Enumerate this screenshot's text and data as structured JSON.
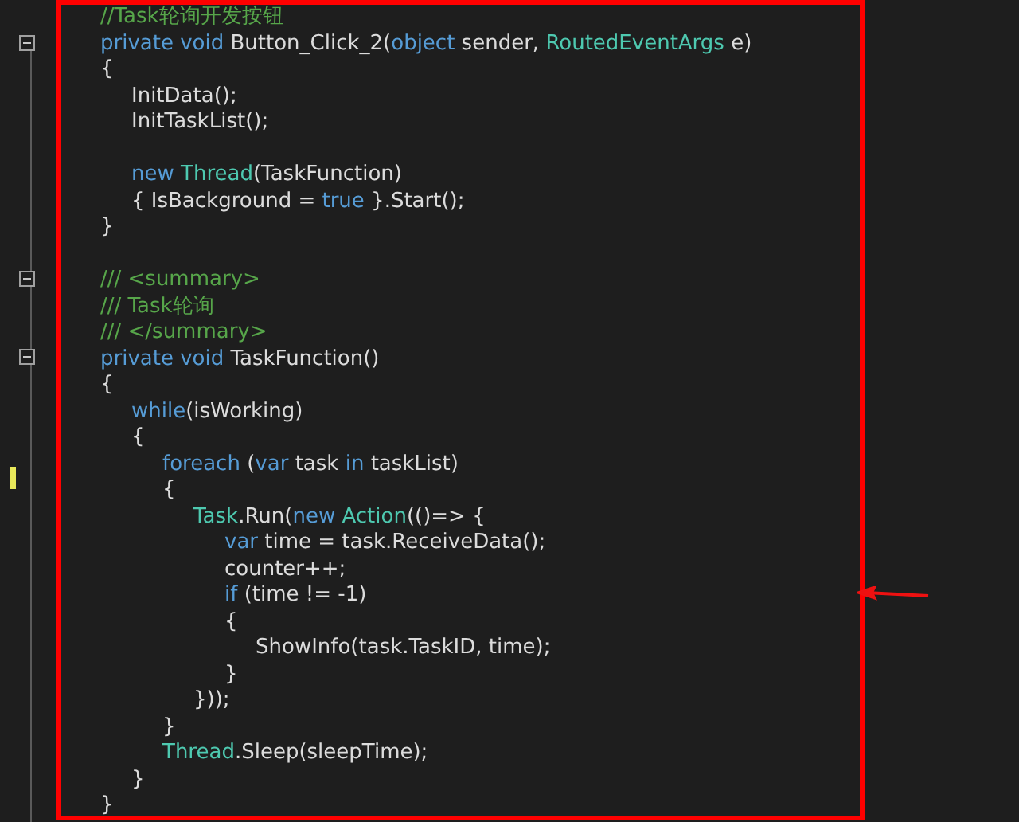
{
  "editor": {
    "lines": [
      {
        "fold": false,
        "changed": false,
        "tokens": [
          {
            "kind": "comment",
            "text": "//Task轮询开发按钮"
          }
        ]
      },
      {
        "fold": true,
        "changed": false,
        "tokens": [
          {
            "kind": "keyword",
            "text": "private void"
          },
          {
            "kind": "plain",
            "text": " Button_Click_2("
          },
          {
            "kind": "keyword",
            "text": "object"
          },
          {
            "kind": "plain",
            "text": " sender, "
          },
          {
            "kind": "type",
            "text": "RoutedEventArgs"
          },
          {
            "kind": "plain",
            "text": " e)"
          }
        ]
      },
      {
        "fold": false,
        "changed": false,
        "tokens": [
          {
            "kind": "plain",
            "text": "{"
          }
        ],
        "children": [
          {
            "fold": false,
            "changed": false,
            "tokens": [
              {
                "kind": "plain",
                "text": "InitData();"
              }
            ]
          },
          {
            "fold": false,
            "changed": false,
            "tokens": [
              {
                "kind": "plain",
                "text": "InitTaskList();"
              }
            ]
          },
          {
            "fold": false,
            "changed": false
          },
          {
            "fold": false,
            "changed": false,
            "tokens": [
              {
                "kind": "keyword",
                "text": "new "
              },
              {
                "kind": "type",
                "text": "Thread"
              },
              {
                "kind": "plain",
                "text": "(TaskFunction)"
              }
            ]
          },
          {
            "fold": false,
            "changed": false,
            "tokens": [
              {
                "kind": "plain",
                "text": "{ IsBackground = "
              },
              {
                "kind": "keyword",
                "text": "true"
              },
              {
                "kind": "plain",
                "text": " }.Start();"
              }
            ]
          }
        ]
      },
      {
        "fold": false,
        "changed": false,
        "tokens": [
          {
            "kind": "plain",
            "text": "}"
          }
        ]
      },
      {
        "fold": false,
        "changed": false
      },
      {
        "fold": true,
        "changed": false,
        "tokens": [
          {
            "kind": "comment",
            "text": "/// <summary>"
          }
        ]
      },
      {
        "fold": false,
        "changed": false,
        "tokens": [
          {
            "kind": "comment",
            "text": "/// Task轮询"
          }
        ]
      },
      {
        "fold": false,
        "changed": false,
        "tokens": [
          {
            "kind": "comment",
            "text": "/// </summary>"
          }
        ]
      },
      {
        "fold": true,
        "changed": false,
        "tokens": [
          {
            "kind": "keyword",
            "text": "private void"
          },
          {
            "kind": "plain",
            "text": " TaskFunction()"
          }
        ]
      },
      {
        "fold": false,
        "changed": false,
        "tokens": [
          {
            "kind": "plain",
            "text": "{"
          }
        ],
        "children": [
          {
            "fold": false,
            "changed": false,
            "tokens": [
              {
                "kind": "keyword",
                "text": "while"
              },
              {
                "kind": "plain",
                "text": "(isWorking)"
              }
            ]
          },
          {
            "fold": false,
            "changed": false,
            "tokens": [
              {
                "kind": "plain",
                "text": "{"
              }
            ],
            "children": [
              {
                "fold": false,
                "changed": false,
                "tokens": [
                  {
                    "kind": "keyword",
                    "text": "foreach"
                  },
                  {
                    "kind": "plain",
                    "text": " ("
                  },
                  {
                    "kind": "keyword",
                    "text": "var"
                  },
                  {
                    "kind": "plain",
                    "text": " task "
                  },
                  {
                    "kind": "keyword",
                    "text": "in"
                  },
                  {
                    "kind": "plain",
                    "text": " taskList)"
                  }
                ]
              },
              {
                "fold": false,
                "changed": true,
                "tokens": [
                  {
                    "kind": "plain",
                    "text": "{"
                  }
                ],
                "children": [
                  {
                    "fold": false,
                    "changed": false,
                    "tokens": [
                      {
                        "kind": "type",
                        "text": "Task"
                      },
                      {
                        "kind": "plain",
                        "text": ".Run("
                      },
                      {
                        "kind": "keyword",
                        "text": "new "
                      },
                      {
                        "kind": "type",
                        "text": "Action"
                      },
                      {
                        "kind": "plain",
                        "text": "(()=> {"
                      }
                    ],
                    "children": [
                      {
                        "fold": false,
                        "changed": false,
                        "tokens": [
                          {
                            "kind": "keyword",
                            "text": "var"
                          },
                          {
                            "kind": "plain",
                            "text": " time = task.ReceiveData();"
                          }
                        ]
                      },
                      {
                        "fold": false,
                        "changed": false,
                        "tokens": [
                          {
                            "kind": "plain",
                            "text": "counter++;"
                          }
                        ]
                      },
                      {
                        "fold": false,
                        "changed": false,
                        "tokens": [
                          {
                            "kind": "keyword",
                            "text": "if"
                          },
                          {
                            "kind": "plain",
                            "text": " (time != -1)"
                          }
                        ]
                      },
                      {
                        "fold": false,
                        "changed": false,
                        "tokens": [
                          {
                            "kind": "plain",
                            "text": "{"
                          }
                        ],
                        "children": [
                          {
                            "fold": false,
                            "changed": false,
                            "tokens": [
                              {
                                "kind": "plain",
                                "text": "ShowInfo(task.TaskID, time);"
                              }
                            ]
                          }
                        ]
                      },
                      {
                        "fold": false,
                        "changed": false,
                        "tokens": [
                          {
                            "kind": "plain",
                            "text": "}"
                          }
                        ]
                      }
                    ]
                  },
                  {
                    "fold": false,
                    "changed": false,
                    "tokens": [
                      {
                        "kind": "plain",
                        "text": "}));"
                      }
                    ]
                  }
                ]
              },
              {
                "fold": false,
                "changed": false,
                "tokens": [
                  {
                    "kind": "plain",
                    "text": "}"
                  }
                ]
              },
              {
                "fold": false,
                "changed": false,
                "tokens": [
                  {
                    "kind": "type",
                    "text": "Thread"
                  },
                  {
                    "kind": "plain",
                    "text": ".Sleep(sleepTime);"
                  }
                ]
              }
            ]
          },
          {
            "fold": false,
            "changed": false,
            "tokens": [
              {
                "kind": "plain",
                "text": "}"
              }
            ]
          }
        ]
      },
      {
        "fold": false,
        "changed": false,
        "tokens": [
          {
            "kind": "plain",
            "text": "}"
          }
        ]
      }
    ]
  }
}
